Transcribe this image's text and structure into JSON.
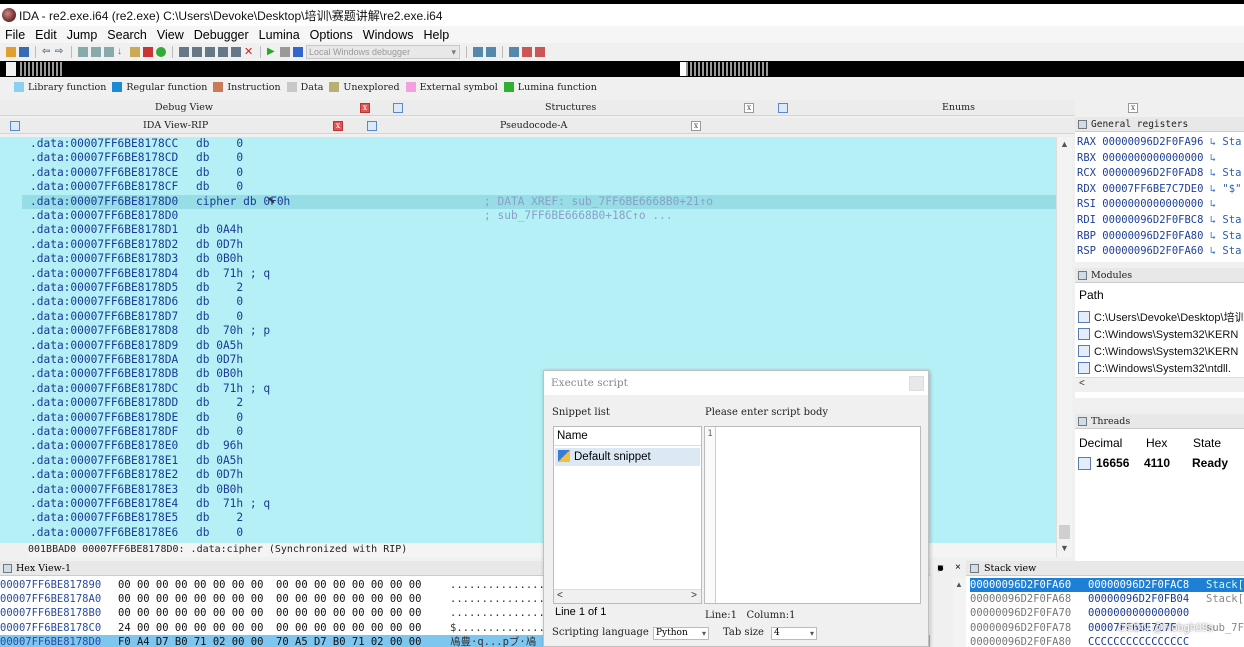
{
  "window": {
    "title": "IDA - re2.exe.i64 (re2.exe) C:\\Users\\Devoke\\Desktop\\培训\\赛题讲解\\re2.exe.i64"
  },
  "menu": [
    "File",
    "Edit",
    "Jump",
    "Search",
    "View",
    "Debugger",
    "Lumina",
    "Options",
    "Windows",
    "Help"
  ],
  "toolbar": {
    "debugger_select": "Local Windows debugger"
  },
  "legend": [
    {
      "label": "Library function",
      "color": "#8ad0f0"
    },
    {
      "label": "Regular function",
      "color": "#1d8ad6"
    },
    {
      "label": "Instruction",
      "color": "#c87a5a"
    },
    {
      "label": "Data",
      "color": "#c8c8c8"
    },
    {
      "label": "Unexplored",
      "color": "#b8b070"
    },
    {
      "label": "External symbol",
      "color": "#f4a0e0"
    },
    {
      "label": "Lumina function",
      "color": "#30b030"
    }
  ],
  "tabs_row1": {
    "debug_view": "Debug View",
    "structures": "Structures",
    "enums": "Enums"
  },
  "tabs_row2": {
    "ida_view": "IDA View-RIP",
    "pseudocode": "Pseudocode-A"
  },
  "disasm": {
    "lines": [
      {
        "addr": ".data:00007FF6BE8178CC",
        "ins": "db    0",
        "cmt": ""
      },
      {
        "addr": ".data:00007FF6BE8178CD",
        "ins": "db    0",
        "cmt": ""
      },
      {
        "addr": ".data:00007FF6BE8178CE",
        "ins": "db    0",
        "cmt": ""
      },
      {
        "addr": ".data:00007FF6BE8178CF",
        "ins": "db    0",
        "cmt": ""
      },
      {
        "addr": ".data:00007FF6BE8178D0",
        "ins": "cipher db 0F0h",
        "cmt": "; DATA XREF: sub_7FF6BE6668B0+21↑o"
      },
      {
        "addr": ".data:00007FF6BE8178D0",
        "ins": "",
        "cmt": "; sub_7FF6BE6668B0+18C↑o ..."
      },
      {
        "addr": ".data:00007FF6BE8178D1",
        "ins": "db 0A4h",
        "cmt": ""
      },
      {
        "addr": ".data:00007FF6BE8178D2",
        "ins": "db 0D7h",
        "cmt": ""
      },
      {
        "addr": ".data:00007FF6BE8178D3",
        "ins": "db 0B0h",
        "cmt": ""
      },
      {
        "addr": ".data:00007FF6BE8178D4",
        "ins": "db  71h ; q",
        "cmt": ""
      },
      {
        "addr": ".data:00007FF6BE8178D5",
        "ins": "db    2",
        "cmt": ""
      },
      {
        "addr": ".data:00007FF6BE8178D6",
        "ins": "db    0",
        "cmt": ""
      },
      {
        "addr": ".data:00007FF6BE8178D7",
        "ins": "db    0",
        "cmt": ""
      },
      {
        "addr": ".data:00007FF6BE8178D8",
        "ins": "db  70h ; p",
        "cmt": ""
      },
      {
        "addr": ".data:00007FF6BE8178D9",
        "ins": "db 0A5h",
        "cmt": ""
      },
      {
        "addr": ".data:00007FF6BE8178DA",
        "ins": "db 0D7h",
        "cmt": ""
      },
      {
        "addr": ".data:00007FF6BE8178DB",
        "ins": "db 0B0h",
        "cmt": ""
      },
      {
        "addr": ".data:00007FF6BE8178DC",
        "ins": "db  71h ; q",
        "cmt": ""
      },
      {
        "addr": ".data:00007FF6BE8178DD",
        "ins": "db    2",
        "cmt": ""
      },
      {
        "addr": ".data:00007FF6BE8178DE",
        "ins": "db    0",
        "cmt": ""
      },
      {
        "addr": ".data:00007FF6BE8178DF",
        "ins": "db    0",
        "cmt": ""
      },
      {
        "addr": ".data:00007FF6BE8178E0",
        "ins": "db  96h",
        "cmt": ""
      },
      {
        "addr": ".data:00007FF6BE8178E1",
        "ins": "db 0A5h",
        "cmt": ""
      },
      {
        "addr": ".data:00007FF6BE8178E2",
        "ins": "db 0D7h",
        "cmt": ""
      },
      {
        "addr": ".data:00007FF6BE8178E3",
        "ins": "db 0B0h",
        "cmt": ""
      },
      {
        "addr": ".data:00007FF6BE8178E4",
        "ins": "db  71h ; q",
        "cmt": ""
      },
      {
        "addr": ".data:00007FF6BE8178E5",
        "ins": "db    2",
        "cmt": ""
      },
      {
        "addr": ".data:00007FF6BE8178E6",
        "ins": "db    0",
        "cmt": ""
      }
    ],
    "status": "001BBAD0 00007FF6BE8178D0: .data:cipher (Synchronized with RIP)"
  },
  "registers": {
    "title": "General registers",
    "rows": [
      {
        "name": "RAX",
        "value": "00000096D2F0FA96",
        "sym": "Sta"
      },
      {
        "name": "RBX",
        "value": "0000000000000000",
        "sym": ""
      },
      {
        "name": "RCX",
        "value": "00000096D2F0FAD8",
        "sym": "Sta"
      },
      {
        "name": "RDX",
        "value": "00007FF6BE7C7DE0",
        "sym": "\"$\""
      },
      {
        "name": "RSI",
        "value": "0000000000000000",
        "sym": ""
      },
      {
        "name": "RDI",
        "value": "00000096D2F0FBC8",
        "sym": "Sta"
      },
      {
        "name": "RBP",
        "value": "00000096D2F0FA80",
        "sym": "Sta"
      },
      {
        "name": "RSP",
        "value": "00000096D2F0FA60",
        "sym": "Sta"
      }
    ]
  },
  "modules": {
    "title": "Modules",
    "header": "Path",
    "rows": [
      "C:\\Users\\Devoke\\Desktop\\培训",
      "C:\\Windows\\System32\\KERN",
      "C:\\Windows\\System32\\KERN",
      "C:\\Windows\\System32\\ntdll."
    ]
  },
  "threads": {
    "title": "Threads",
    "headers": [
      "Decimal",
      "Hex",
      "State"
    ],
    "row": {
      "decimal": "16656",
      "hex": "4110",
      "state": "Ready"
    }
  },
  "hex_view": {
    "title": "Hex View-1",
    "lines": [
      {
        "addr": "00007FF6BE817890",
        "bytes": "00 00 00 00 00 00 00 00  00 00 00 00 00 00 00 00",
        "ascii": "................"
      },
      {
        "addr": "00007FF6BE8178A0",
        "bytes": "00 00 00 00 00 00 00 00  00 00 00 00 00 00 00 00",
        "ascii": "................"
      },
      {
        "addr": "00007FF6BE8178B0",
        "bytes": "00 00 00 00 00 00 00 00  00 00 00 00 00 00 00 00",
        "ascii": "................"
      },
      {
        "addr": "00007FF6BE8178C0",
        "bytes": "24 00 00 00 00 00 00 00  00 00 00 00 00 00 00 00",
        "ascii": "$..............."
      },
      {
        "addr": "00007FF6BE8178D0",
        "bytes": "F0 A4 D7 B0 71 02 00 00  70 A5 D7 B0 71 02 00 00",
        "ascii": "鳰豊·q...pブ·鳰"
      }
    ]
  },
  "stack_view": {
    "title": "Stack view",
    "lines": [
      {
        "addr": "00000096D2F0FA60",
        "val": "00000096D2F0FAC8",
        "sym": "Stack["
      },
      {
        "addr": "00000096D2F0FA68",
        "val": "00000096D2F0FB04",
        "sym": "Stack["
      },
      {
        "addr": "00000096D2F0FA70",
        "val": "0000000000000000",
        "sym": ""
      },
      {
        "addr": "00000096D2F0FA78",
        "val": "00007FF6BE7C7F",
        "sym": "sub_7F"
      },
      {
        "addr": "00000096D2F0FA80",
        "val": "CCCCCCCCCCCCCCCC",
        "sym": ""
      }
    ],
    "watermark": "CSDN @Hobgh09s"
  },
  "dialog": {
    "title": "Execute script",
    "snippet_list_label": "Snippet list",
    "script_body_label": "Please enter script body",
    "list_header": "Name",
    "snippet": "Default snippet",
    "line_num": "1",
    "position": "Line 1 of 1",
    "cursor": "Line:1   Column:1",
    "lang_label": "Scripting language",
    "lang_value": "Python",
    "tab_label": "Tab size",
    "tab_value": "4"
  }
}
